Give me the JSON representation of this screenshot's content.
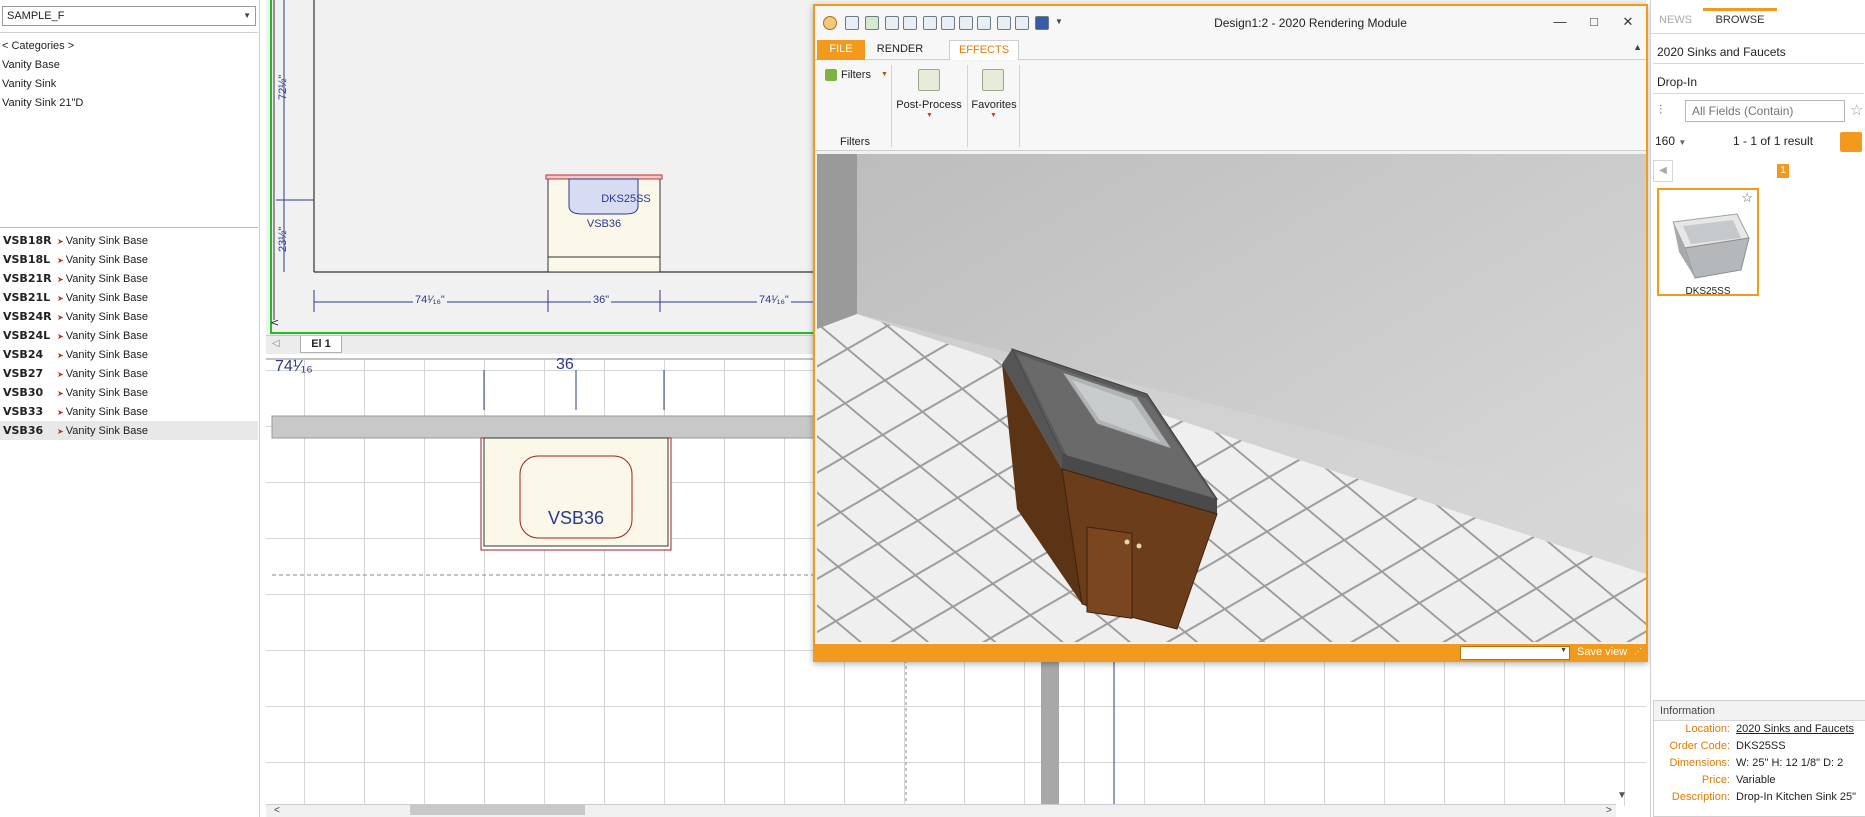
{
  "left_panel": {
    "catalog": "SAMPLE_F",
    "tree": [
      "< Categories >",
      "Vanity Base",
      "Vanity Sink",
      "Vanity Sink 21\"D"
    ],
    "items": [
      {
        "code": "VSB18R",
        "desc": "Vanity Sink Base"
      },
      {
        "code": "VSB18L",
        "desc": "Vanity Sink Base"
      },
      {
        "code": "VSB21R",
        "desc": "Vanity Sink Base"
      },
      {
        "code": "VSB21L",
        "desc": "Vanity Sink Base"
      },
      {
        "code": "VSB24R",
        "desc": "Vanity Sink Base"
      },
      {
        "code": "VSB24L",
        "desc": "Vanity Sink Base"
      },
      {
        "code": "VSB24",
        "desc": "Vanity Sink Base"
      },
      {
        "code": "VSB27",
        "desc": "Vanity Sink Base"
      },
      {
        "code": "VSB30",
        "desc": "Vanity Sink Base"
      },
      {
        "code": "VSB33",
        "desc": "Vanity Sink Base"
      },
      {
        "code": "VSB36",
        "desc": "Vanity Sink Base"
      }
    ]
  },
  "elevation": {
    "dim_left_vertical_top": "72½\"",
    "dim_left_vertical_bottom": "23½\"",
    "dim_bottom_left": "74¹⁄₁₆\"",
    "dim_bottom_mid": "36\"",
    "dim_bottom_right": "74¹⁄₁₆\"",
    "sink_label": "DKS25SS",
    "cabinet_label": "VSB36",
    "tab": "El 1"
  },
  "plan": {
    "dim_top_left": "74¹⁄₁₆",
    "dim_top_mid": "36",
    "cabinet_label": "VSB36"
  },
  "render_window": {
    "title": "Design1:2 - 2020 Rendering Module",
    "tabs": [
      "FILE",
      "RENDER",
      "EFFECTS"
    ],
    "ribbon": {
      "filters_button": "Filters",
      "post_process": "Post-Process",
      "favorites": "Favorites",
      "group_label": "Filters"
    },
    "status": {
      "view_select": "",
      "save_view": "Save view"
    },
    "controls": {
      "minimize": "—",
      "maximize": "□",
      "close": "✕"
    }
  },
  "right_panel": {
    "tabs": [
      "NEWS",
      "BROWSE"
    ],
    "catalog": "2020 Sinks and Faucets",
    "category": "Drop-In",
    "search_placeholder": "All Fields (Contain)",
    "page_size": "160",
    "results": "1 - 1 of 1 result",
    "page": "1",
    "card_label": "DKS25SS",
    "info": {
      "header": "Information",
      "location_label": "Location:",
      "location": "2020 Sinks and Faucets",
      "order_label": "Order Code:",
      "order": "DKS25SS",
      "dims_label": "Dimensions:",
      "dims": "W:  25\"   H:  12 1/8\"   D:  2",
      "price_label": "Price:",
      "price": "Variable",
      "desc_label": "Description:",
      "desc": "Drop-In Kitchen Sink 25\""
    }
  },
  "colors": {
    "accent": "#f29a1e",
    "selection_green": "#1ec01e",
    "dimension_blue": "#2b3a8c"
  }
}
